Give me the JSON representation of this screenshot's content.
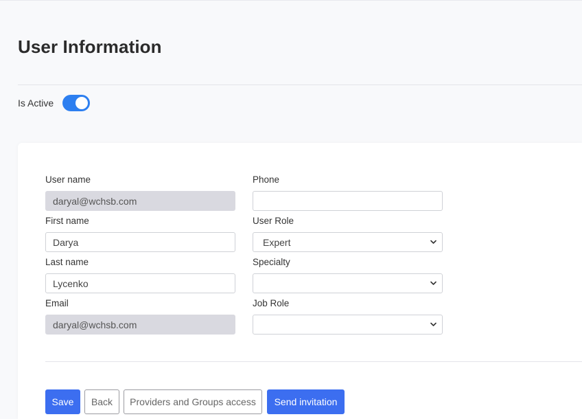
{
  "page": {
    "title": "User Information"
  },
  "status": {
    "is_active_label": "Is Active",
    "is_active": true
  },
  "form": {
    "username": {
      "label": "User name",
      "value": "daryal@wchsb.com"
    },
    "first_name": {
      "label": "First name",
      "value": "Darya"
    },
    "last_name": {
      "label": "Last name",
      "value": "Lycenko"
    },
    "email": {
      "label": "Email",
      "value": "daryal@wchsb.com"
    },
    "phone": {
      "label": "Phone",
      "value": ""
    },
    "user_role": {
      "label": "User Role",
      "value": "Expert"
    },
    "specialty": {
      "label": "Specialty",
      "value": ""
    },
    "job_role": {
      "label": "Job Role",
      "value": ""
    }
  },
  "actions": {
    "save": "Save",
    "back": "Back",
    "providers_groups": "Providers and Groups access",
    "send_invitation": "Send invitation"
  },
  "colors": {
    "accent": "#3c6ef0",
    "toggle_on": "#2d7ff0",
    "readonly_bg": "#d9d9e0"
  }
}
